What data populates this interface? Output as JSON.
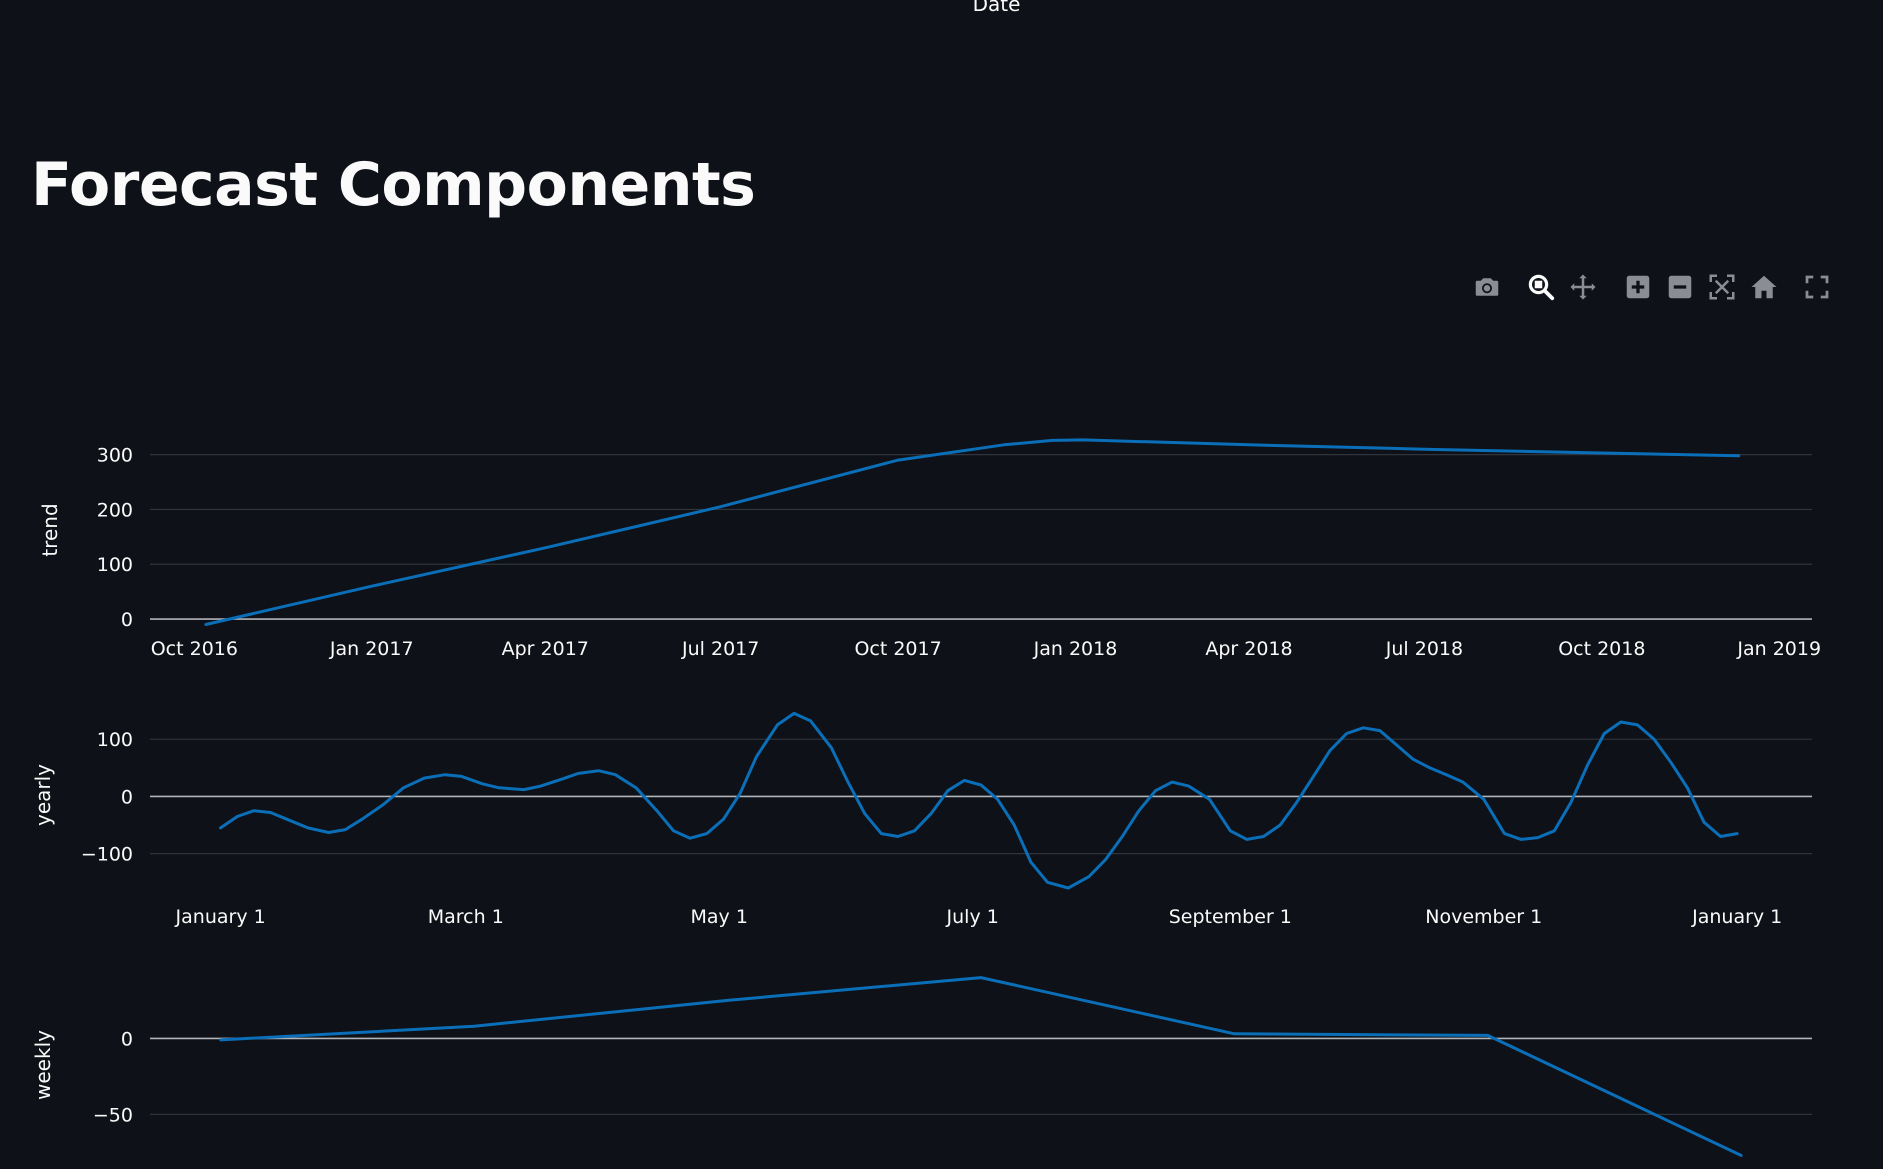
{
  "header": {
    "date_label": "Date",
    "title": "Forecast Components"
  },
  "modebar": {
    "icons": [
      "camera-icon",
      "zoom-icon",
      "pan-icon",
      "zoom-in-icon",
      "zoom-out-icon",
      "autoscale-icon",
      "home-icon",
      "fullscreen-icon"
    ]
  },
  "colors": {
    "background": "#0e1117",
    "line": "#0a6fb8",
    "grid": "#30343c",
    "zeroline": "#b0b3b8",
    "text": "#fafafa",
    "modebar_icon": "#8a8d93"
  },
  "chart_data": [
    {
      "type": "line",
      "ylabel": "trend",
      "x_axis": "date",
      "ylim": [
        -20,
        345
      ],
      "yticks": [
        0,
        100,
        200,
        300
      ],
      "xticks": [
        {
          "v": "2016-10-01",
          "label": "Oct 2016"
        },
        {
          "v": "2017-01-01",
          "label": "Jan 2017"
        },
        {
          "v": "2017-04-01",
          "label": "Apr 2017"
        },
        {
          "v": "2017-07-01",
          "label": "Jul 2017"
        },
        {
          "v": "2017-10-01",
          "label": "Oct 2017"
        },
        {
          "v": "2018-01-01",
          "label": "Jan 2018"
        },
        {
          "v": "2018-04-01",
          "label": "Apr 2018"
        },
        {
          "v": "2018-07-01",
          "label": "Jul 2018"
        },
        {
          "v": "2018-10-01",
          "label": "Oct 2018"
        },
        {
          "v": "2019-01-01",
          "label": "Jan 2019"
        }
      ],
      "xlim": [
        "2016-09-08",
        "2019-01-18"
      ],
      "series": [
        {
          "x": [
            "2016-10-07",
            "2017-01-01",
            "2017-04-01",
            "2017-07-01",
            "2017-10-01",
            "2017-11-25",
            "2017-12-20",
            "2018-01-05",
            "2018-04-01",
            "2018-07-01",
            "2018-10-01",
            "2018-12-11"
          ],
          "y": [
            -10,
            60,
            130,
            205,
            290,
            318,
            326,
            327,
            318,
            310,
            303,
            298
          ]
        }
      ]
    },
    {
      "type": "line",
      "ylabel": "yearly",
      "x_axis": "day_of_year",
      "ylim": [
        -160,
        165
      ],
      "yticks": [
        -100,
        0,
        100
      ],
      "ytick_labels": [
        "−100",
        "0",
        "100"
      ],
      "xticks": [
        {
          "v": 1,
          "label": "January 1"
        },
        {
          "v": 60,
          "label": "March 1"
        },
        {
          "v": 121,
          "label": "May 1"
        },
        {
          "v": 182,
          "label": "July 1"
        },
        {
          "v": 244,
          "label": "September 1"
        },
        {
          "v": 305,
          "label": "November 1"
        },
        {
          "v": 366,
          "label": "January 1"
        }
      ],
      "xlim": [
        -16,
        384
      ],
      "series": [
        {
          "x": [
            1,
            5,
            9,
            13,
            17,
            22,
            27,
            31,
            35,
            40,
            45,
            50,
            55,
            59,
            64,
            68,
            74,
            78,
            83,
            87,
            92,
            96,
            101,
            106,
            110,
            114,
            118,
            122,
            126,
            130,
            135,
            139,
            143,
            148,
            152,
            156,
            160,
            164,
            168,
            172,
            176,
            180,
            184,
            188,
            192,
            196,
            200,
            205,
            210,
            214,
            218,
            222,
            226,
            230,
            234,
            239,
            244,
            248,
            252,
            256,
            260,
            264,
            268,
            272,
            276,
            280,
            284,
            288,
            292,
            296,
            300,
            305,
            310,
            314,
            318,
            322,
            326,
            330,
            334,
            338,
            342,
            346,
            350,
            354,
            358,
            362,
            366
          ],
          "y": [
            -55,
            -35,
            -25,
            -28,
            -40,
            -55,
            -63,
            -58,
            -40,
            -15,
            15,
            32,
            38,
            35,
            22,
            15,
            12,
            18,
            30,
            40,
            45,
            38,
            15,
            -25,
            -60,
            -73,
            -65,
            -40,
            5,
            70,
            125,
            145,
            132,
            85,
            25,
            -30,
            -65,
            -70,
            -60,
            -30,
            10,
            28,
            20,
            -5,
            -50,
            -115,
            -150,
            -160,
            -140,
            -110,
            -70,
            -25,
            10,
            25,
            18,
            -5,
            -60,
            -75,
            -70,
            -50,
            -10,
            35,
            80,
            110,
            120,
            115,
            90,
            65,
            50,
            38,
            25,
            -5,
            -65,
            -75,
            -72,
            -60,
            -10,
            55,
            110,
            130,
            125,
            100,
            60,
            15,
            -45,
            -70,
            -65
          ]
        }
      ]
    },
    {
      "type": "line",
      "ylabel": "weekly",
      "x_axis": "weekday_index",
      "ylim": [
        -80,
        45
      ],
      "yticks": [
        -50,
        0
      ],
      "ytick_labels": [
        "−50",
        "0"
      ],
      "xlim": [
        -0.28,
        6.28
      ],
      "series": [
        {
          "x": [
            0,
            1,
            2,
            3,
            4,
            5,
            6
          ],
          "y": [
            -1,
            8,
            25,
            40,
            3,
            2,
            -77
          ]
        }
      ]
    }
  ]
}
